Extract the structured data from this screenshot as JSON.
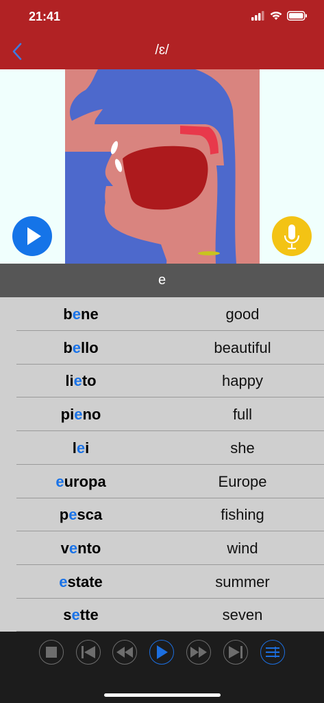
{
  "status": {
    "time": "21:41"
  },
  "header": {
    "title": "/ɛ/"
  },
  "sound": {
    "letter": "e"
  },
  "words": [
    {
      "pre": "b",
      "hl": "e",
      "post": "ne",
      "translation": "good"
    },
    {
      "pre": "b",
      "hl": "e",
      "post": "llo",
      "translation": "beautiful"
    },
    {
      "pre": "li",
      "hl": "e",
      "post": "to",
      "translation": "happy"
    },
    {
      "pre": "pi",
      "hl": "e",
      "post": "no",
      "translation": "full"
    },
    {
      "pre": "l",
      "hl": "e",
      "post": "i",
      "translation": "she"
    },
    {
      "pre": "",
      "hl": "e",
      "post": "uropa",
      "translation": "Europe"
    },
    {
      "pre": "p",
      "hl": "e",
      "post": "sca",
      "translation": "fishing"
    },
    {
      "pre": "v",
      "hl": "e",
      "post": "nto",
      "translation": "wind"
    },
    {
      "pre": "",
      "hl": "e",
      "post": "state",
      "translation": "summer"
    },
    {
      "pre": "s",
      "hl": "e",
      "post": "tte",
      "translation": "seven"
    }
  ],
  "colors": {
    "accent": "#1574e8",
    "header": "#b12224",
    "mic": "#f3c314",
    "highlight": "#1a73e8"
  },
  "icons": [
    "back-chevron-icon",
    "play-icon",
    "microphone-icon",
    "stop-icon",
    "skip-previous-icon",
    "rewind-icon",
    "play-icon",
    "fast-forward-icon",
    "skip-next-icon",
    "list-icon"
  ]
}
